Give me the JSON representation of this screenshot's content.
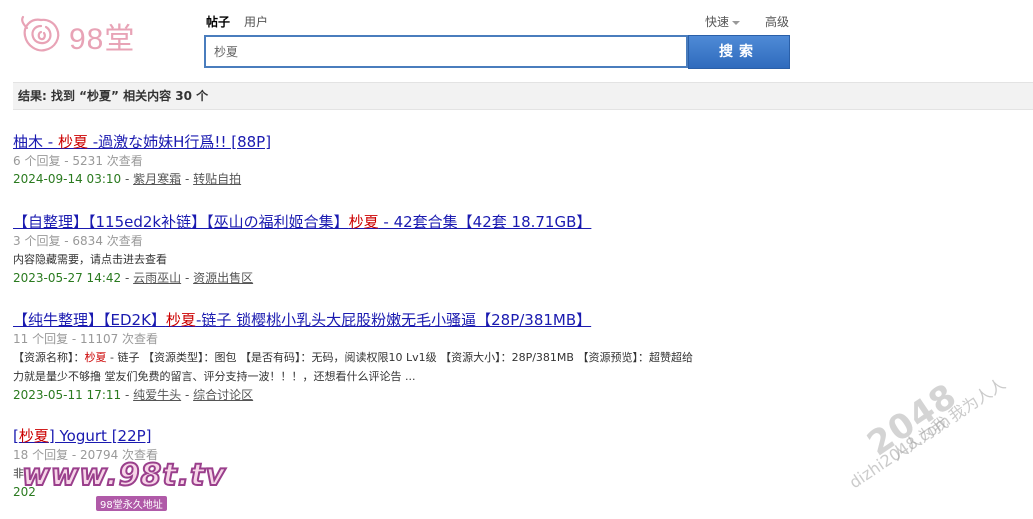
{
  "logo": {
    "text": "98堂"
  },
  "search": {
    "tabs": [
      {
        "label": "帖子",
        "active": true
      },
      {
        "label": "用户",
        "active": false
      }
    ],
    "quick_label": "快速",
    "advanced_label": "高级",
    "query": "杪夏",
    "button_label": "搜索"
  },
  "result_summary": "结果: 找到 “杪夏” 相关内容 30 个",
  "results": [
    {
      "title_before": "柚木 - ",
      "title_highlight": "杪夏",
      "title_after": " -過激な姉妹H行爲!! [88P]",
      "meta": "6 个回复 - 5231 次查看",
      "body": "",
      "date": "2024-09-14 03:10",
      "author": "紫月寒霜",
      "forum": "转贴自拍"
    },
    {
      "title_before": "【自整理】【115ed2k补链】【巫山の福利姬合集】",
      "title_highlight": "杪夏",
      "title_after": " - 42套合集【42套 18.71GB】",
      "meta": "3 个回复 - 6834 次查看",
      "body": "内容隐藏需要，请点击进去查看",
      "date": "2023-05-27 14:42",
      "author": "云雨巫山",
      "forum": "资源出售区"
    },
    {
      "title_before": "【纯牛整理】【ED2K】",
      "title_highlight": "杪夏",
      "title_after": "-链子 锁樱桃小乳头大屁股粉嫩无毛小骚逼【28P/381MB】",
      "meta": "11 个回复 - 11107 次查看",
      "body_line1_prefix": "【资源名称】：",
      "body_line1_highlight": "杪夏",
      "body_line1_rest": " - 链子 【资源类型】：图包 【是否有码】：无码，阅读权限10 Lv1级 【资源大小】：28P/381MB 【资源预览】：超赞超给",
      "body_line2": "力就是量少不够撸 堂友们免费的留言、评分支持一波！！！，还想看什么评论告 ...",
      "date": "2023-05-11 17:11",
      "author": "纯爱牛头",
      "forum": "综合讨论区"
    },
    {
      "title_before": "[",
      "title_highlight": "杪夏",
      "title_after": "] Yogurt [22P]",
      "meta": "18 个回复 - 20794 次查看",
      "body": "非",
      "date": "202",
      "author": "",
      "forum": ""
    }
  ],
  "watermarks": {
    "right_big": "2048",
    "right_line1": "人人为我 我为人人",
    "right_line2": "dizhi2048.com",
    "left_big": "www.98t.tv",
    "left_small": "98堂永久地址"
  },
  "colors": {
    "link": "#1a1ab0",
    "highlight": "#c00000",
    "date": "#2a7a1f",
    "button": "#2f6bbd",
    "border": "#4a7dbd"
  }
}
